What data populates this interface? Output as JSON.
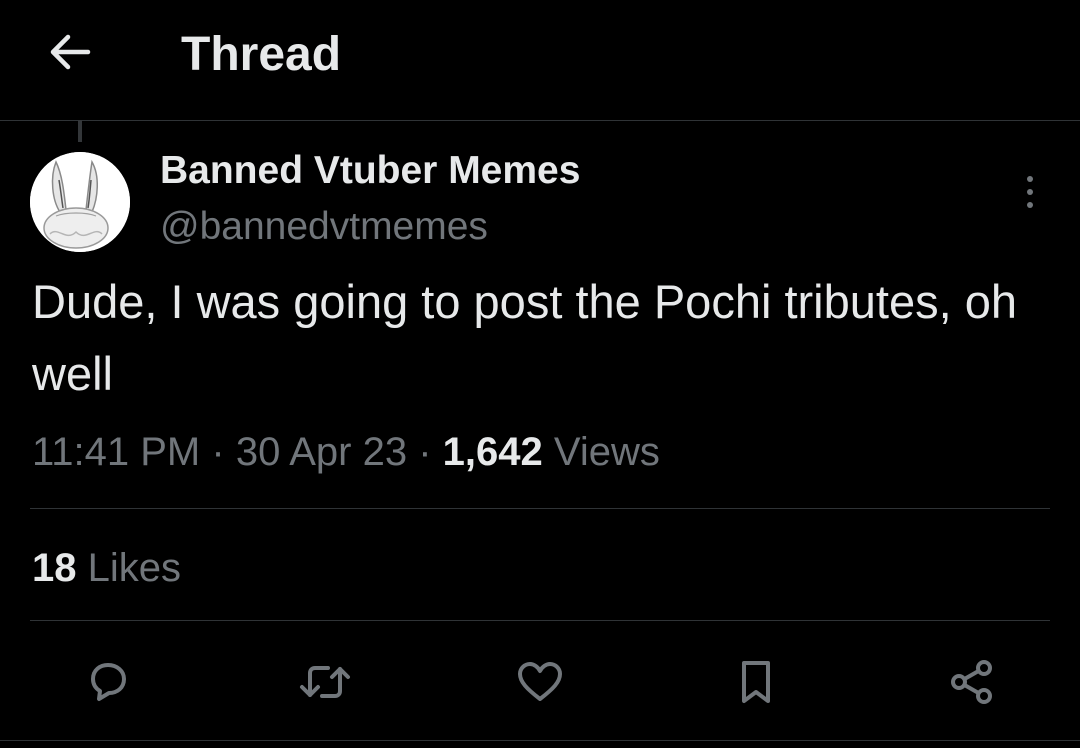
{
  "header": {
    "title": "Thread",
    "back_icon": "arrow-left-icon"
  },
  "tweet": {
    "display_name": "Banned Vtuber Memes",
    "handle": "@bannedvtmemes",
    "text": "Dude, I was going to post the Pochi tributes, oh well",
    "time": "11:41 PM",
    "separator": "·",
    "date": "30 Apr 23",
    "views_count": "1,642",
    "views_label": "Views",
    "likes_count": "18",
    "likes_label": "Likes"
  },
  "actions": [
    {
      "icon": "reply-icon"
    },
    {
      "icon": "retweet-icon"
    },
    {
      "icon": "like-icon"
    },
    {
      "icon": "bookmark-icon"
    },
    {
      "icon": "share-icon"
    }
  ],
  "colors": {
    "background": "#000000",
    "primary_text": "#e7e9ea",
    "secondary_text": "#71767b",
    "divider": "#2f3336"
  }
}
